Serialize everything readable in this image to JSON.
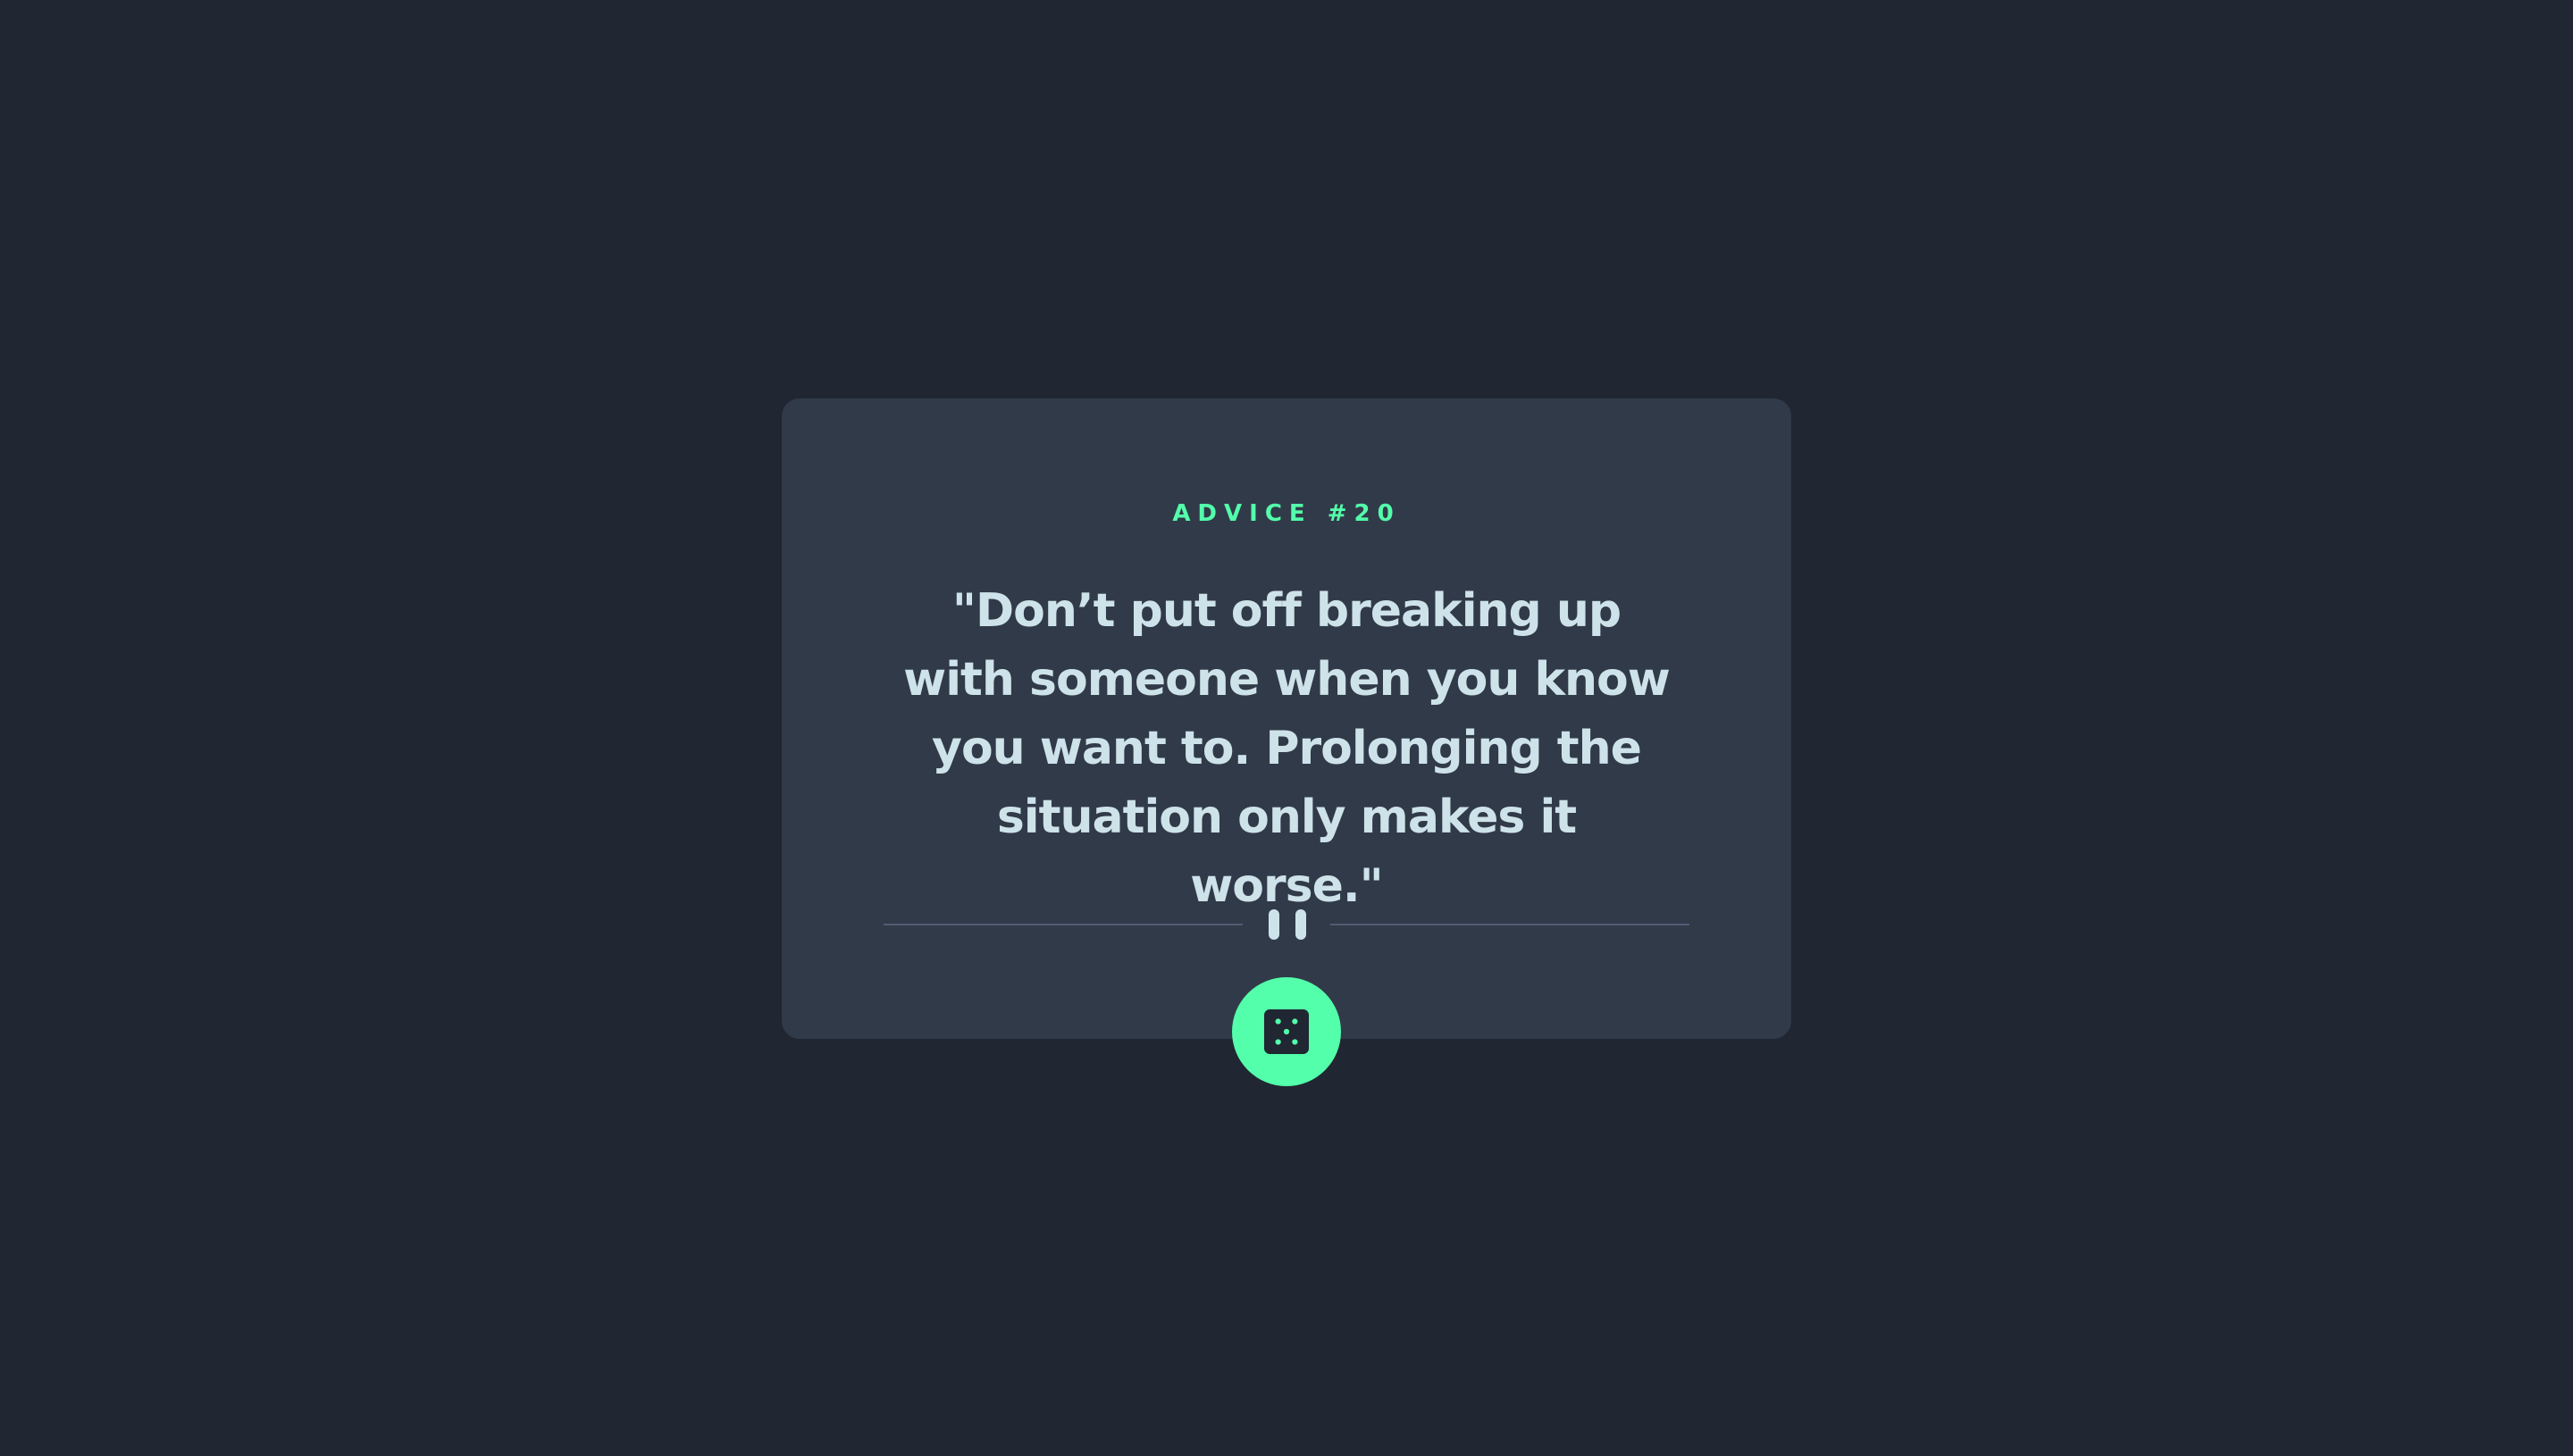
{
  "card": {
    "advice_label": "ADVICE #20",
    "quote": "\"Don’t put off breaking up with someone when you know you want to. Prolonging the situation only makes it worse.\""
  },
  "divider": {
    "icon": "pause-icon"
  },
  "dice_button": {
    "icon": "dice-icon"
  },
  "colors": {
    "background": "#202632",
    "card": "#313a49",
    "accent": "#53ffaa",
    "text": "#cee3e9",
    "divider": "#4f5d74"
  }
}
